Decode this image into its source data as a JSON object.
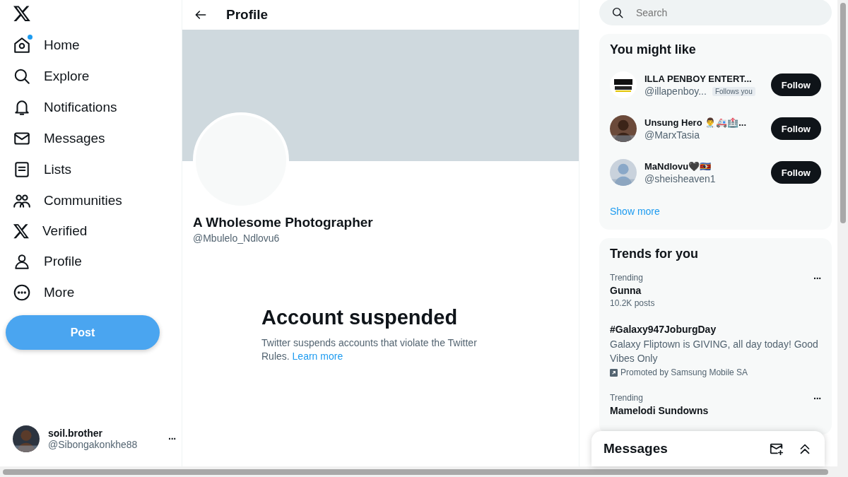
{
  "nav": {
    "items": [
      {
        "label": "Home",
        "badge": true
      },
      {
        "label": "Explore",
        "badge": false
      },
      {
        "label": "Notifications",
        "badge": false
      },
      {
        "label": "Messages",
        "badge": false
      },
      {
        "label": "Lists",
        "badge": false
      },
      {
        "label": "Communities",
        "badge": false
      },
      {
        "label": "Verified",
        "badge": false
      },
      {
        "label": "Profile",
        "badge": false
      },
      {
        "label": "More",
        "badge": false
      }
    ],
    "post_button": "Post",
    "account": {
      "name": "soil.brother",
      "handle": "@Sibongakonkhe88",
      "more": "···"
    }
  },
  "header": {
    "title": "Profile"
  },
  "profile": {
    "name": "A Wholesome Photographer",
    "handle": "@Mbulelo_Ndlovu6"
  },
  "suspended": {
    "title": "Account suspended",
    "message": "Twitter suspends accounts that violate the Twitter Rules.",
    "link": "Learn more"
  },
  "search": {
    "placeholder": "Search"
  },
  "who_to_follow": {
    "title": "You might like",
    "items": [
      {
        "name": "ILLA PENBOY ENTERT...",
        "handle": "@illapenboy...",
        "follows_you": "Follows you",
        "button": "Follow",
        "kind": "logo"
      },
      {
        "name": "Unsung Hero 👨‍⚕️🚑🏥...",
        "handle": "@MarxTasia",
        "button": "Follow",
        "kind": "picture"
      },
      {
        "name": "MaNdlovu🖤🇸🇿",
        "handle": "@sheisheaven1",
        "button": "Follow",
        "kind": "picture"
      }
    ],
    "show_more": "Show more"
  },
  "trends": {
    "title": "Trends for you",
    "items": [
      {
        "kind": "trend",
        "context": "Trending",
        "name": "Gunna",
        "count": "10.2K posts",
        "more": "···"
      },
      {
        "kind": "promoted",
        "name": "#Galaxy947JoburgDay",
        "description": "Galaxy Fliptown is GIVING, all day today! Good Vibes Only",
        "promoter": "Promoted by Samsung Mobile SA"
      },
      {
        "kind": "trend",
        "context": "Trending",
        "name": "Mamelodi Sundowns",
        "more": "···"
      }
    ]
  },
  "messages_drawer": {
    "title": "Messages"
  }
}
